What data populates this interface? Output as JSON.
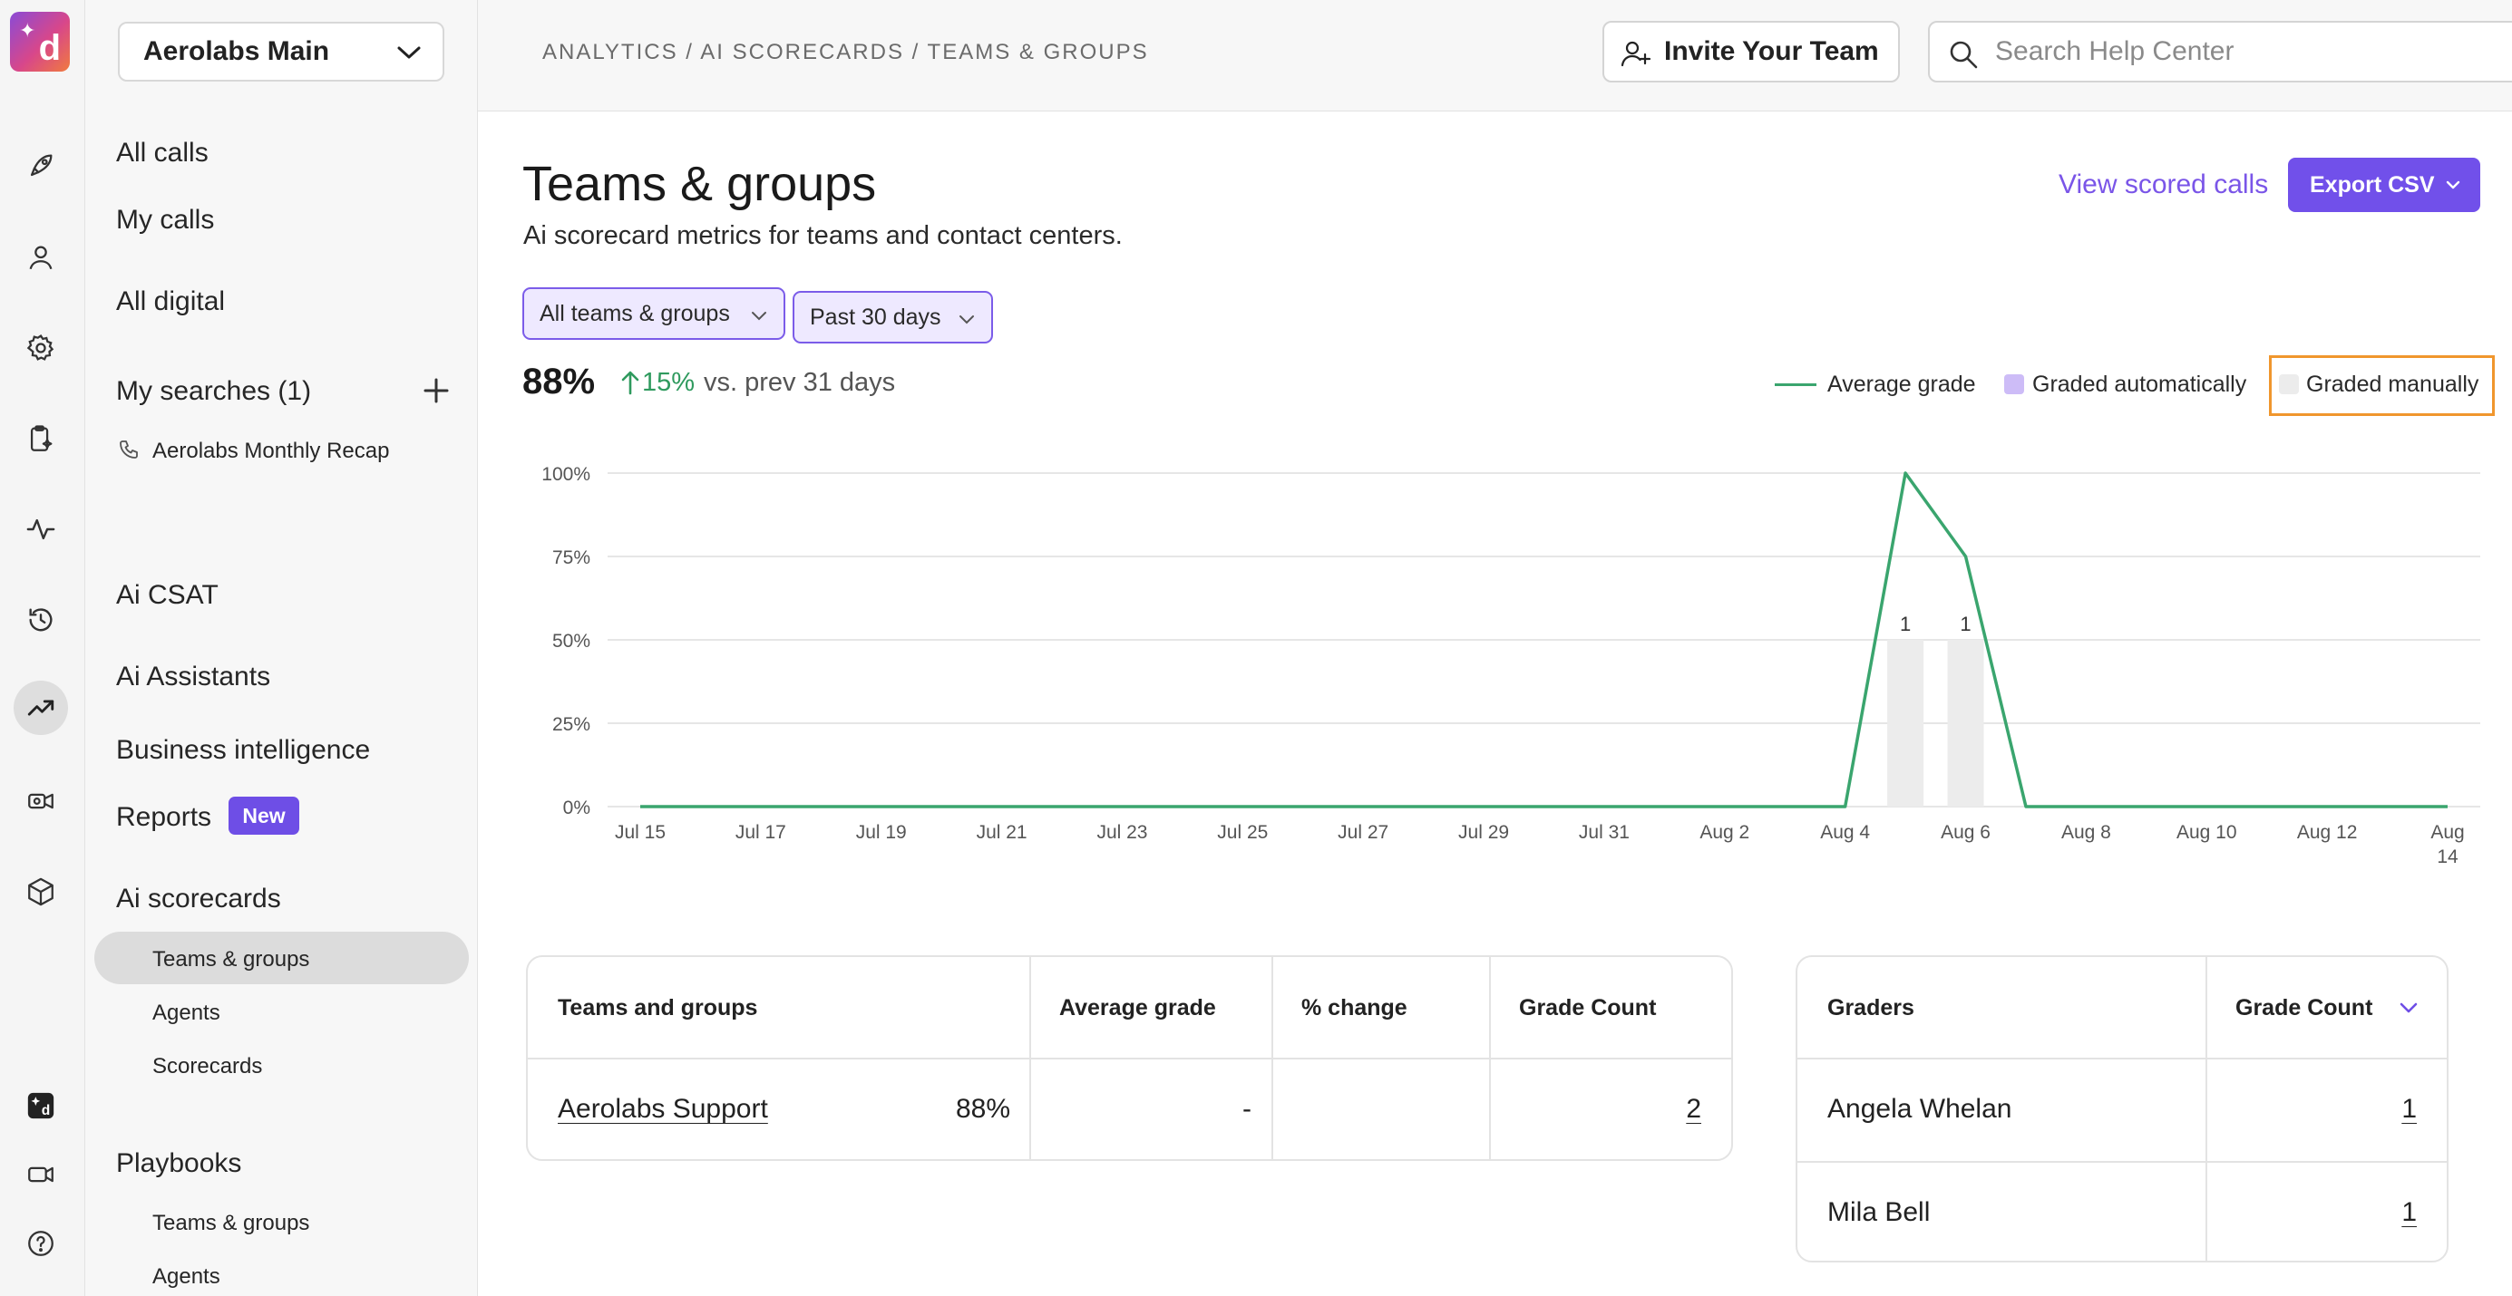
{
  "workspace": {
    "name": "Aerolabs Main"
  },
  "header": {
    "breadcrumb": "ANALYTICS / AI SCORECARDS / TEAMS & GROUPS",
    "invite_label": "Invite Your Team",
    "search_placeholder": "Search Help Center"
  },
  "sidebar": {
    "all_calls": "All calls",
    "my_calls": "My calls",
    "all_digital": "All digital",
    "my_searches": "My searches (1)",
    "saved_search": "Aerolabs Monthly Recap",
    "ai_csat": "Ai CSAT",
    "ai_assistants": "Ai Assistants",
    "business_intelligence": "Business intelligence",
    "reports": "Reports",
    "reports_badge": "New",
    "ai_scorecards": "Ai scorecards",
    "scorecards_items": [
      "Teams & groups",
      "Agents",
      "Scorecards"
    ],
    "playbooks": "Playbooks",
    "playbooks_items": [
      "Teams & groups",
      "Agents"
    ]
  },
  "page": {
    "title": "Teams & groups",
    "subtitle": "Ai scorecard metrics for teams and contact centers.",
    "view_scored_calls": "View scored calls",
    "export_label": "Export CSV",
    "filter_teams": "All teams & groups",
    "filter_period": "Past 30 days",
    "kpi_value": "88%",
    "kpi_change": "15%",
    "kpi_vs": "vs. prev 31 days"
  },
  "legend": {
    "average_grade": "Average grade",
    "graded_automatically": "Graded automatically",
    "graded_manually": "Graded manually"
  },
  "colors": {
    "accent": "#7150ea",
    "line": "#3aa56e",
    "auto_bar": "#cdbcf7",
    "manual_bar": "#ececec",
    "positive": "#2f9a5e",
    "highlight": "#f0962d"
  },
  "chart_data": {
    "type": "line",
    "x": [
      "Jul 15",
      "Jul 16",
      "Jul 17",
      "Jul 18",
      "Jul 19",
      "Jul 20",
      "Jul 21",
      "Jul 22",
      "Jul 23",
      "Jul 24",
      "Jul 25",
      "Jul 26",
      "Jul 27",
      "Jul 28",
      "Jul 29",
      "Jul 30",
      "Jul 31",
      "Aug 1",
      "Aug 2",
      "Aug 3",
      "Aug 4",
      "Aug 5",
      "Aug 6",
      "Aug 7",
      "Aug 8",
      "Aug 9",
      "Aug 10",
      "Aug 11",
      "Aug 12",
      "Aug 13",
      "Aug 14"
    ],
    "tick_labels": [
      "Jul 15",
      "Jul 17",
      "Jul 19",
      "Jul 21",
      "Jul 23",
      "Jul 25",
      "Jul 27",
      "Jul 29",
      "Jul 31",
      "Aug 2",
      "Aug 4",
      "Aug 6",
      "Aug 8",
      "Aug 10",
      "Aug 12",
      "Aug 14"
    ],
    "y_ticks": [
      "0%",
      "25%",
      "50%",
      "75%",
      "100%"
    ],
    "ylim": [
      0,
      100
    ],
    "series": [
      {
        "name": "Average grade",
        "values": [
          0,
          0,
          0,
          0,
          0,
          0,
          0,
          0,
          0,
          0,
          0,
          0,
          0,
          0,
          0,
          0,
          0,
          0,
          0,
          0,
          0,
          100,
          75,
          0,
          0,
          0,
          0,
          0,
          0,
          0,
          0
        ]
      }
    ],
    "bars": [
      {
        "x": "Aug 5",
        "count": 1,
        "label": "1",
        "type": "Graded manually"
      },
      {
        "x": "Aug 6",
        "count": 1,
        "label": "1",
        "type": "Graded manually"
      }
    ],
    "grid": true,
    "legend_position": "top-right"
  },
  "teams_table": {
    "headers": [
      "Teams and groups",
      "Average grade",
      "% change",
      "Grade Count"
    ],
    "rows": [
      {
        "name": "Aerolabs Support",
        "average": "88%",
        "change": "-",
        "count": "2"
      }
    ]
  },
  "graders_table": {
    "headers": [
      "Graders",
      "Grade Count"
    ],
    "rows": [
      {
        "name": "Angela Whelan",
        "count": "1"
      },
      {
        "name": "Mila Bell",
        "count": "1"
      }
    ]
  }
}
